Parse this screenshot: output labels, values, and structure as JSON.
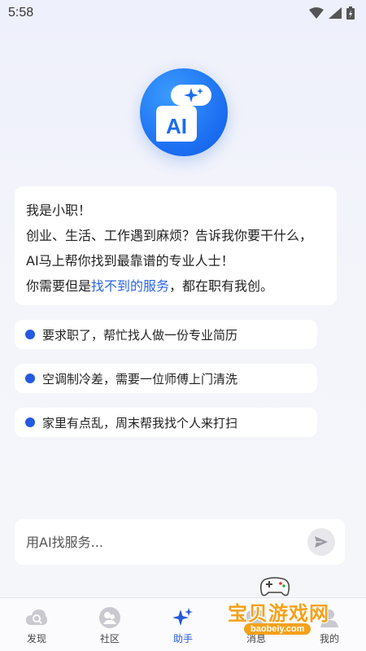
{
  "status": {
    "time": "5:58"
  },
  "intro": {
    "line1": "我是小职！",
    "line2": "创业、生活、工作遇到麻烦？告诉我你要干什么，",
    "line3": "AI马上帮你找到最靠谱的专业人士！",
    "line4_before": "你需要但是",
    "line4_highlight": "找不到的服务",
    "line4_after": "，都在职有我创。"
  },
  "logo": {
    "text": "AI"
  },
  "suggestions": [
    {
      "label": "要求职了，帮忙找人做一份专业简历"
    },
    {
      "label": "空调制冷差，需要一位师傅上门清洗"
    },
    {
      "label": "家里有点乱，周末帮我找个人来打扫"
    }
  ],
  "input": {
    "placeholder": "用AI找服务..."
  },
  "tabs": [
    {
      "label": "发现",
      "icon": "discover-icon"
    },
    {
      "label": "社区",
      "icon": "community-icon"
    },
    {
      "label": "助手",
      "icon": "assistant-sparkle-icon"
    },
    {
      "label": "消息",
      "icon": "message-icon"
    },
    {
      "label": "我的",
      "icon": "profile-icon"
    }
  ],
  "watermark": {
    "title": "宝贝游戏网",
    "domain": "baobeiy.com"
  },
  "colors": {
    "accent": "#2459e0",
    "highlight": "#2b66e8",
    "logo": "#1a6cf0",
    "watermark": "#f5a11b"
  }
}
